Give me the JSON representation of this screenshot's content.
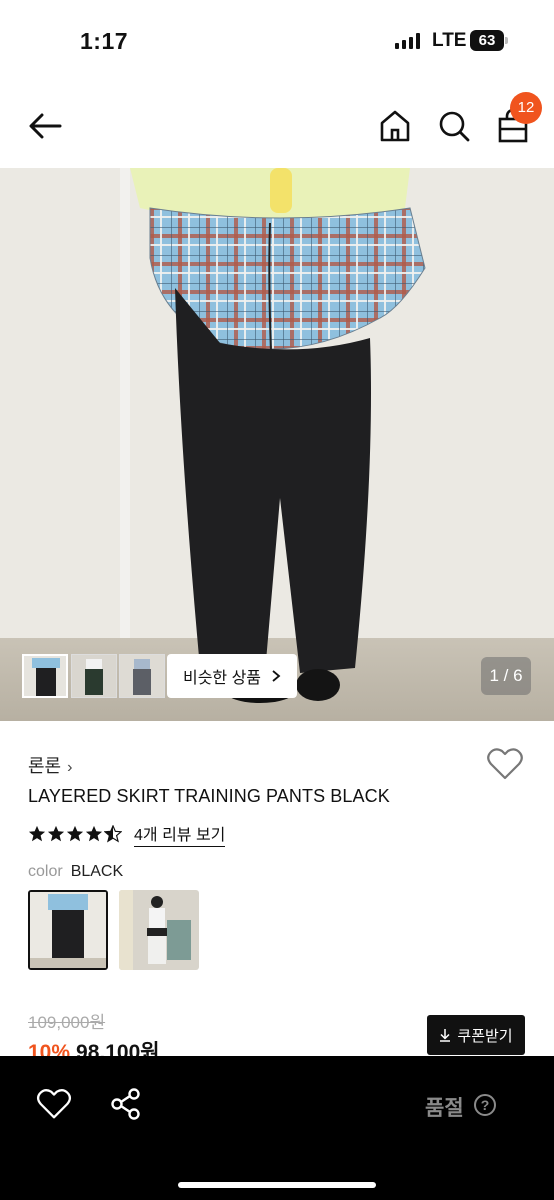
{
  "status_bar": {
    "time": "1:17",
    "network": "LTE",
    "battery": "63"
  },
  "nav": {
    "back_icon": "arrow-left-icon",
    "home_icon": "home-icon",
    "search_icon": "search-icon",
    "cart_icon": "shopping-bag-icon",
    "cart_count": "12"
  },
  "gallery": {
    "similar_button": "비슷한 상품",
    "page_counter": "1 / 6"
  },
  "product": {
    "brand": "론론",
    "title": "LAYERED SKIRT TRAINING PANTS BLACK",
    "rating": 4.5,
    "review_link": "4개 리뷰 보기",
    "color_label": "color",
    "color_value": "BLACK",
    "original_price": "109,000원",
    "discount": "10%",
    "sale_price": "98,100원",
    "coupon_button": "쿠폰받기"
  },
  "bottom_bar": {
    "status": "품절",
    "help": "?"
  },
  "colors": {
    "accent": "#f0541e",
    "bottom_bar": "#000000"
  }
}
